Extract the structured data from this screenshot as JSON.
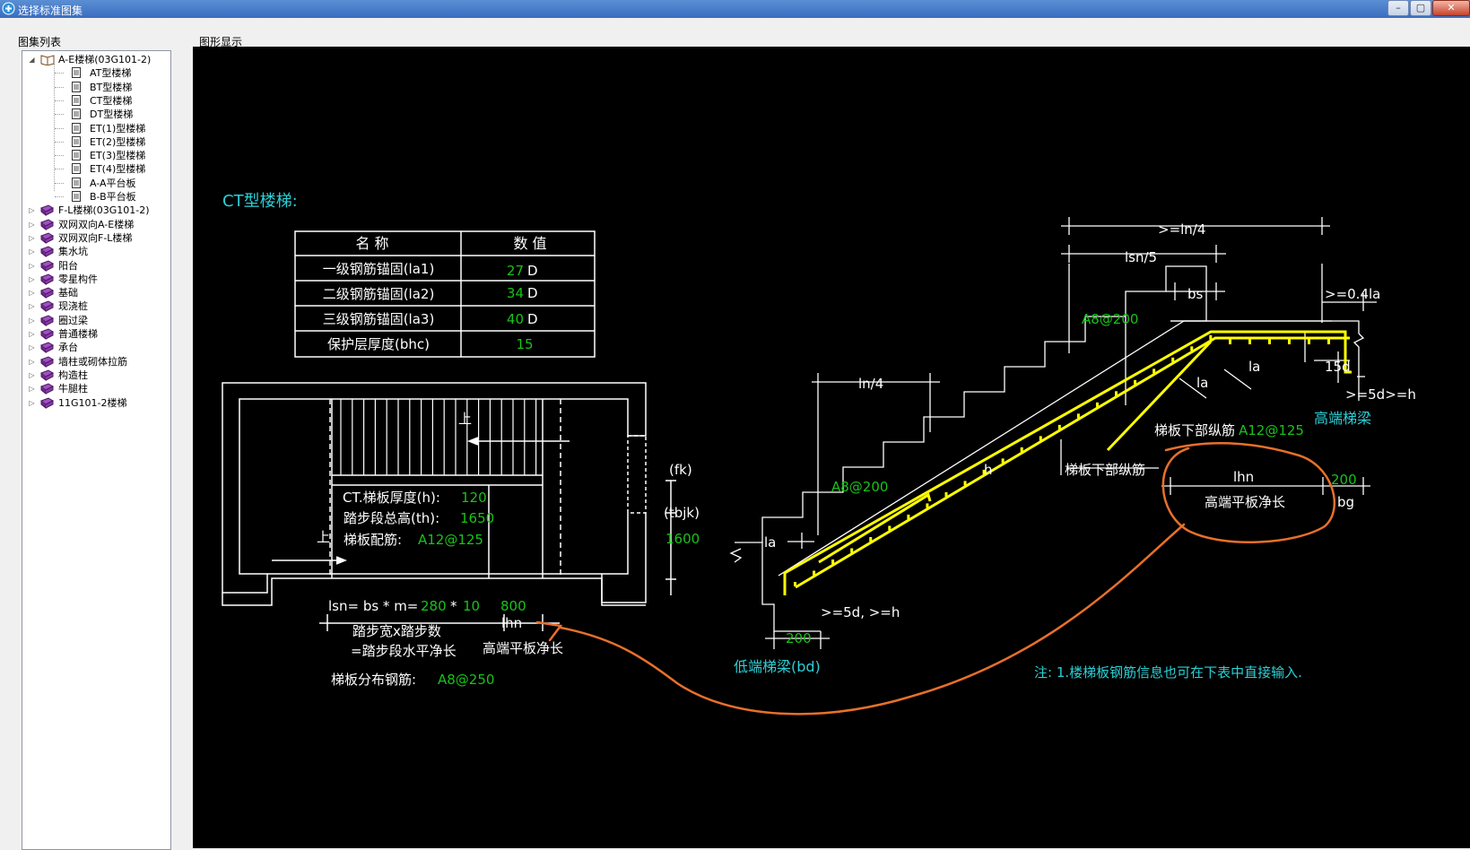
{
  "window": {
    "title": "选择标准图集",
    "buttons": [
      "–",
      "▢",
      "✕"
    ]
  },
  "panels": {
    "tree_label": "图集列表",
    "graphic_label": "图形显示"
  },
  "tree": [
    {
      "label": "A-E楼梯(03G101-2)",
      "level": 0,
      "expanded": true,
      "icon": "open-book-icon"
    },
    {
      "label": "AT型楼梯",
      "level": 1,
      "icon": "document-icon"
    },
    {
      "label": "BT型楼梯",
      "level": 1,
      "icon": "document-icon"
    },
    {
      "label": "CT型楼梯",
      "level": 1,
      "icon": "document-icon"
    },
    {
      "label": "DT型楼梯",
      "level": 1,
      "icon": "document-icon"
    },
    {
      "label": "ET(1)型楼梯",
      "level": 1,
      "icon": "document-icon"
    },
    {
      "label": "ET(2)型楼梯",
      "level": 1,
      "icon": "document-icon"
    },
    {
      "label": "ET(3)型楼梯",
      "level": 1,
      "icon": "document-icon"
    },
    {
      "label": "ET(4)型楼梯",
      "level": 1,
      "icon": "document-icon"
    },
    {
      "label": "A-A平台板",
      "level": 1,
      "icon": "document-icon"
    },
    {
      "label": "B-B平台板",
      "level": 1,
      "icon": "document-icon"
    },
    {
      "label": "F-L楼梯(03G101-2)",
      "level": 0,
      "icon": "book-icon"
    },
    {
      "label": "双网双向A-E楼梯",
      "level": 0,
      "icon": "book-icon"
    },
    {
      "label": "双网双向F-L楼梯",
      "level": 0,
      "icon": "book-icon"
    },
    {
      "label": "集水坑",
      "level": 0,
      "icon": "book-icon"
    },
    {
      "label": "阳台",
      "level": 0,
      "icon": "book-icon"
    },
    {
      "label": "零星构件",
      "level": 0,
      "icon": "book-icon"
    },
    {
      "label": "基础",
      "level": 0,
      "icon": "book-icon"
    },
    {
      "label": "现浇桩",
      "level": 0,
      "icon": "book-icon"
    },
    {
      "label": "圈过梁",
      "level": 0,
      "icon": "book-icon"
    },
    {
      "label": "普通楼梯",
      "level": 0,
      "icon": "book-icon"
    },
    {
      "label": "承台",
      "level": 0,
      "icon": "book-icon"
    },
    {
      "label": "墙柱或砌体拉筋",
      "level": 0,
      "icon": "book-icon"
    },
    {
      "label": "构造柱",
      "level": 0,
      "icon": "book-icon"
    },
    {
      "label": "牛腿柱",
      "level": 0,
      "icon": "book-icon"
    },
    {
      "label": "11G101-2楼梯",
      "level": 0,
      "icon": "book-icon"
    }
  ],
  "drawing": {
    "title": "CT型楼梯:",
    "table": {
      "headers": [
        "名  称",
        "数  值"
      ],
      "rows": [
        {
          "name": "一级钢筋锚固(la1)",
          "value": "27",
          "unit": "D"
        },
        {
          "name": "二级钢筋锚固(la2)",
          "value": "34",
          "unit": "D"
        },
        {
          "name": "三级钢筋锚固(la3)",
          "value": "40",
          "unit": "D"
        },
        {
          "name": "保护层厚度(bhc)",
          "value": "15",
          "unit": ""
        }
      ]
    },
    "plan": {
      "up_label": "上",
      "thickness_label": "CT.梯板厚度(h):",
      "thickness_value": "120",
      "height_label": "踏步段总高(th):",
      "height_value": "1650",
      "rebar_label": "梯板配筋:",
      "rebar_value": "A12@125",
      "fk_label": "(fk)",
      "tbjk_label": "(tbjk)",
      "tbjk_value": "1600",
      "lsn_formula": "lsn= bs * m=",
      "bs_value": "280",
      "times": "*",
      "m_value": "10",
      "lhn_value": "800",
      "lhn_label": "lhn",
      "step_desc1": "踏步宽x踏步数",
      "step_desc2": "=踏步段水平净长",
      "high_end_plate": "高端平板净长",
      "dist_rebar_label": "梯板分布钢筋:",
      "dist_rebar_value": "A8@250"
    },
    "section": {
      "ln4_top": ">=ln/4",
      "lsn5": "lsn/5",
      "bs": "bs",
      "ge04la": ">=0.4la",
      "a8_top": "A8@200",
      "la1": "la",
      "la2": "la",
      "d15": "15d",
      "ge5d_h": ">=5d>=h",
      "high_beam": "高端梯梁",
      "bottom_long_bar_label": "梯板下部纵筋",
      "bottom_long_bar_value": "A12@125",
      "bottom_long_bar2": "梯板下部纵筋",
      "ln4": "ln/4",
      "h": "h",
      "a8_left": "A8@200",
      "la_left": "la",
      "ge5d_h2": ">=5d, >=h",
      "beam_value": "200",
      "low_beam": "低端梯梁(bd)",
      "lhn": "lhn",
      "lhn_value": "200",
      "bg": "bg",
      "high_plate": "高端平板净长",
      "note": "注: 1.楼梯板钢筋信息也可在下表中直接输入."
    },
    "colors": {
      "white": "#ffffff",
      "green": "#19c219",
      "cyan": "#2bd0d6",
      "yellow": "#ffff00",
      "orange": "#e8702a"
    }
  }
}
